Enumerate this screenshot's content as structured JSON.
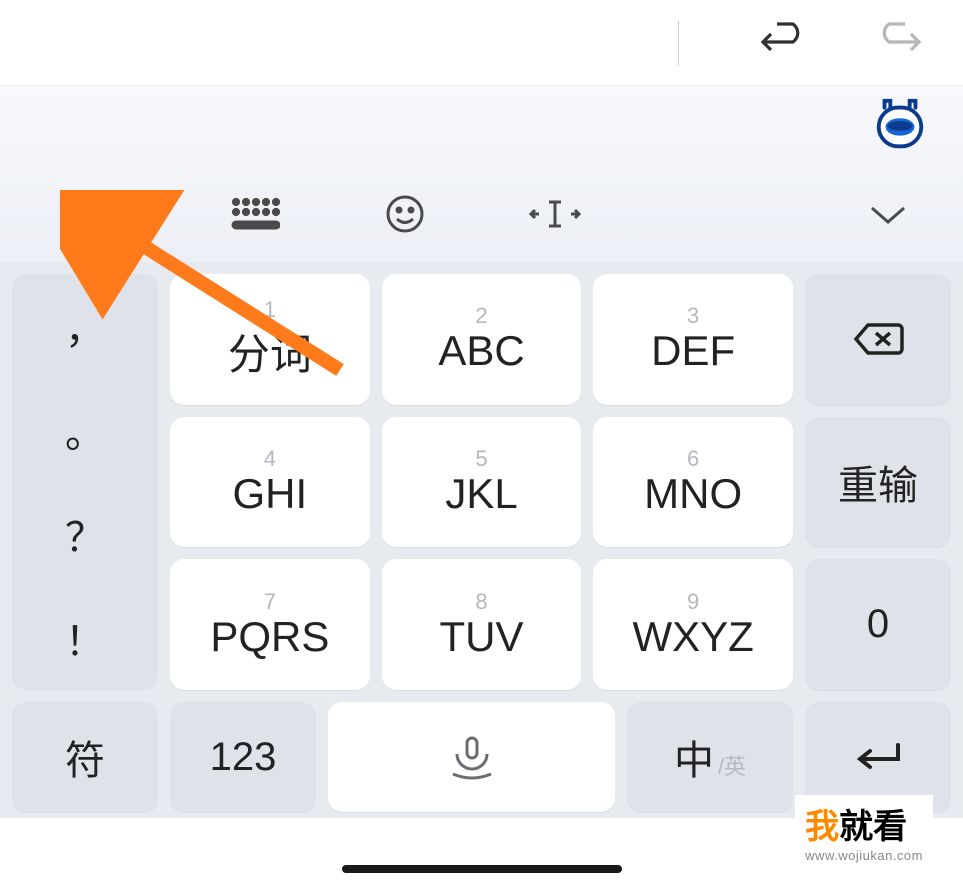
{
  "topbar": {
    "undo": "undo",
    "redo": "redo"
  },
  "toolbar": {
    "menu_icon": "apps-grid-icon",
    "keyboard_icon": "keyboard-layout-icon",
    "emoji_icon": "emoji-icon",
    "cursor_icon": "cursor-move-icon",
    "collapse_icon": "chevron-down-icon"
  },
  "left_punct": [
    "，",
    "。",
    "？",
    "！"
  ],
  "keys": {
    "r1": [
      {
        "n": "1",
        "l": "分词"
      },
      {
        "n": "2",
        "l": "ABC"
      },
      {
        "n": "3",
        "l": "DEF"
      }
    ],
    "r2": [
      {
        "n": "4",
        "l": "GHI"
      },
      {
        "n": "5",
        "l": "JKL"
      },
      {
        "n": "6",
        "l": "MNO"
      }
    ],
    "r3": [
      {
        "n": "7",
        "l": "PQRS"
      },
      {
        "n": "8",
        "l": "TUV"
      },
      {
        "n": "9",
        "l": "WXYZ"
      }
    ]
  },
  "right": {
    "backspace": "⌫",
    "reinput": "重输",
    "zero": "0"
  },
  "bottom": {
    "symbol": "符",
    "numeric": "123",
    "lang_main": "中",
    "lang_sub": "/英",
    "enter": "↵"
  },
  "watermark": {
    "t1a": "我",
    "t1b": "就看",
    "url": "www.wojiukan.com"
  }
}
